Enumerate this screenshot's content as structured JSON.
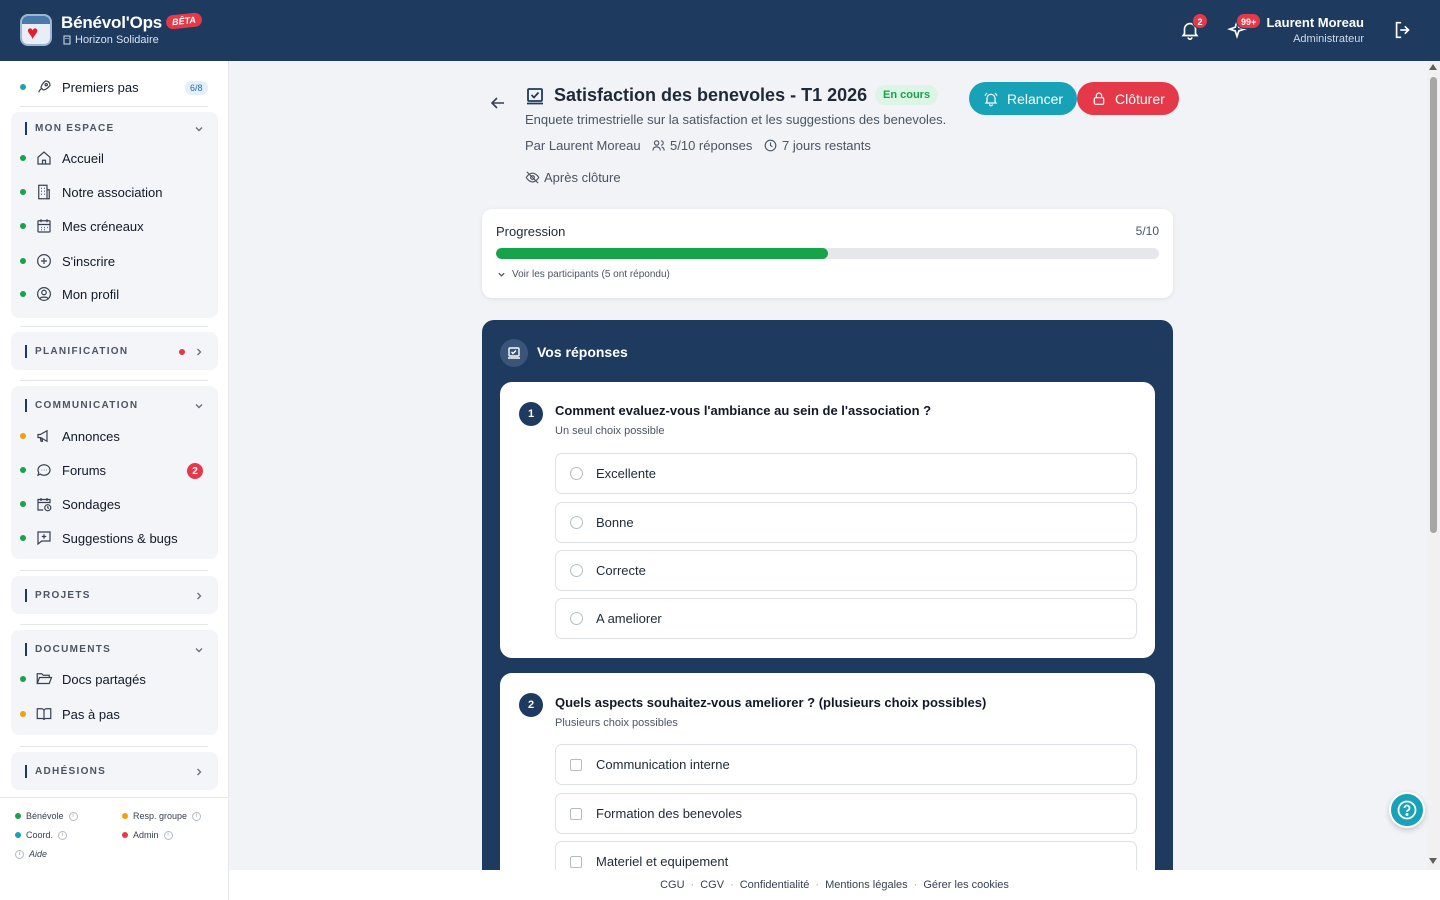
{
  "header": {
    "app_name": "Bénévol'Ops",
    "beta": "BÊTA",
    "org": "Horizon Solidaire",
    "notif_count": "2",
    "activity_count": "99+",
    "user_name": "Laurent Moreau",
    "user_role": "Administrateur"
  },
  "sidebar": {
    "first_steps": {
      "label": "Premiers pas",
      "count": "6/8"
    },
    "mon_espace": {
      "title": "MON ESPACE",
      "items": [
        "Accueil",
        "Notre association",
        "Mes créneaux",
        "S'inscrire",
        "Mon profil"
      ]
    },
    "planification": {
      "title": "PLANIFICATION"
    },
    "communication": {
      "title": "COMMUNICATION",
      "items": [
        "Annonces",
        "Forums",
        "Sondages",
        "Suggestions & bugs"
      ],
      "forums_badge": "2"
    },
    "projets": {
      "title": "PROJETS"
    },
    "documents": {
      "title": "DOCUMENTS",
      "items": [
        "Docs partagés",
        "Pas à pas"
      ]
    },
    "adhesions": {
      "title": "ADHÉSIONS"
    },
    "legend": {
      "benevole": "Bénévole",
      "resp": "Resp. groupe",
      "coord": "Coord.",
      "admin": "Admin",
      "aide": "Aide"
    }
  },
  "survey": {
    "title": "Satisfaction des benevoles - T1 2026",
    "status": "En cours",
    "description": "Enquete trimestrielle sur la satisfaction et les suggestions des benevoles.",
    "author": "Par Laurent Moreau",
    "responses": "5/10 réponses",
    "remaining": "7 jours restants",
    "visibility": "Après clôture",
    "relaunch": "Relancer",
    "close": "Clôturer"
  },
  "progress": {
    "label": "Progression",
    "value": "5/10",
    "fraction": 0.5,
    "participants": "Voir les participants (5 ont répondu)"
  },
  "answers": {
    "title": "Vos réponses",
    "q1": {
      "num": "1",
      "text": "Comment evaluez-vous l'ambiance au sein de l'association ?",
      "hint": "Un seul choix possible",
      "options": [
        "Excellente",
        "Bonne",
        "Correcte",
        "A ameliorer"
      ]
    },
    "q2": {
      "num": "2",
      "text": "Quels aspects souhaitez-vous ameliorer ? (plusieurs choix possibles)",
      "hint": "Plusieurs choix possibles",
      "options": [
        "Communication interne",
        "Formation des benevoles",
        "Materiel et equipement"
      ]
    }
  },
  "footer": {
    "links": [
      "CGU",
      "CGV",
      "Confidentialité",
      "Mentions légales",
      "Gérer les cookies"
    ]
  },
  "colors": {
    "navy": "#1e3a5f",
    "teal": "#17a2b8",
    "red": "#e53949",
    "green": "#16a34a",
    "orange": "#f59e0b"
  }
}
